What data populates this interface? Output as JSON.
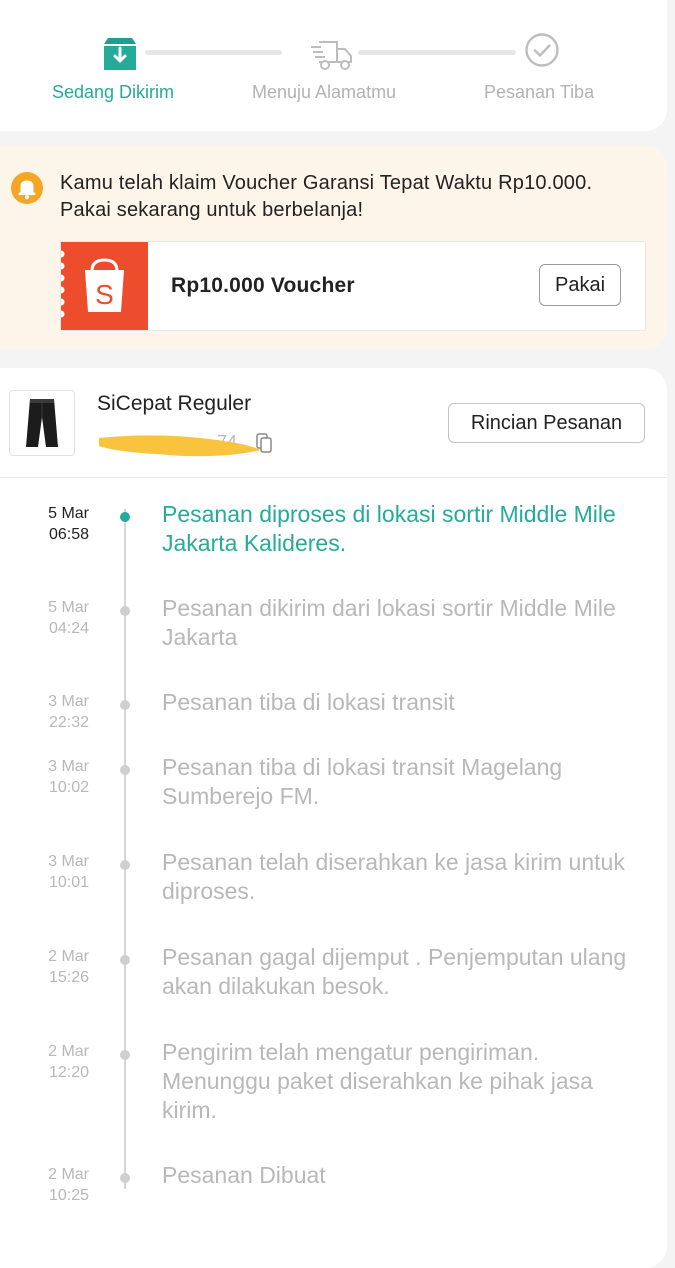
{
  "progress": {
    "steps": [
      {
        "label": "Sedang Dikirim",
        "state": "active"
      },
      {
        "label": "Menuju Alamatmu",
        "state": "inactive"
      },
      {
        "label": "Pesanan Tiba",
        "state": "inactive"
      }
    ]
  },
  "voucher_banner": {
    "icon": "bell-icon",
    "message": "Kamu telah klaim Voucher Garansi Tepat Waktu Rp10.000. Pakai sekarang untuk berbelanja!",
    "voucher_title": "Rp10.000 Voucher",
    "button_label": "Pakai",
    "brand_color": "#ee4d2d"
  },
  "shipment": {
    "courier": "SiCepat Reguler",
    "details_button": "Rincian Pesanan"
  },
  "timeline": [
    {
      "day": "5 Mar",
      "time": "06:58",
      "text": "Pesanan diproses di lokasi sortir  Middle Mile Jakarta Kalideres.",
      "current": true
    },
    {
      "day": "5 Mar",
      "time": "04:24",
      "text": "Pesanan dikirim dari lokasi sortir  Middle Mile Jakarta",
      "current": false
    },
    {
      "day": "3 Mar",
      "time": "22:32",
      "text": "Pesanan tiba di lokasi transit",
      "current": false
    },
    {
      "day": "3 Mar",
      "time": "10:02",
      "text": "Pesanan tiba di lokasi transit  Magelang Sumberejo FM.",
      "current": false
    },
    {
      "day": "3 Mar",
      "time": "10:01",
      "text": "Pesanan telah diserahkan ke jasa kirim untuk diproses.",
      "current": false
    },
    {
      "day": "2 Mar",
      "time": "15:26",
      "text": "Pesanan gagal dijemput . Penjemputan ulang akan dilakukan besok.",
      "current": false
    },
    {
      "day": "2 Mar",
      "time": "12:20",
      "text": "Pengirim telah mengatur pengiriman. Menunggu paket diserahkan ke pihak jasa kirim.",
      "current": false
    },
    {
      "day": "2 Mar",
      "time": "10:25",
      "text": "Pesanan Dibuat",
      "current": false
    }
  ],
  "colors": {
    "accent": "#26aa99",
    "inactive": "#b8b8b8",
    "banner_bg": "#fdf5e9",
    "bell": "#f5a623"
  }
}
